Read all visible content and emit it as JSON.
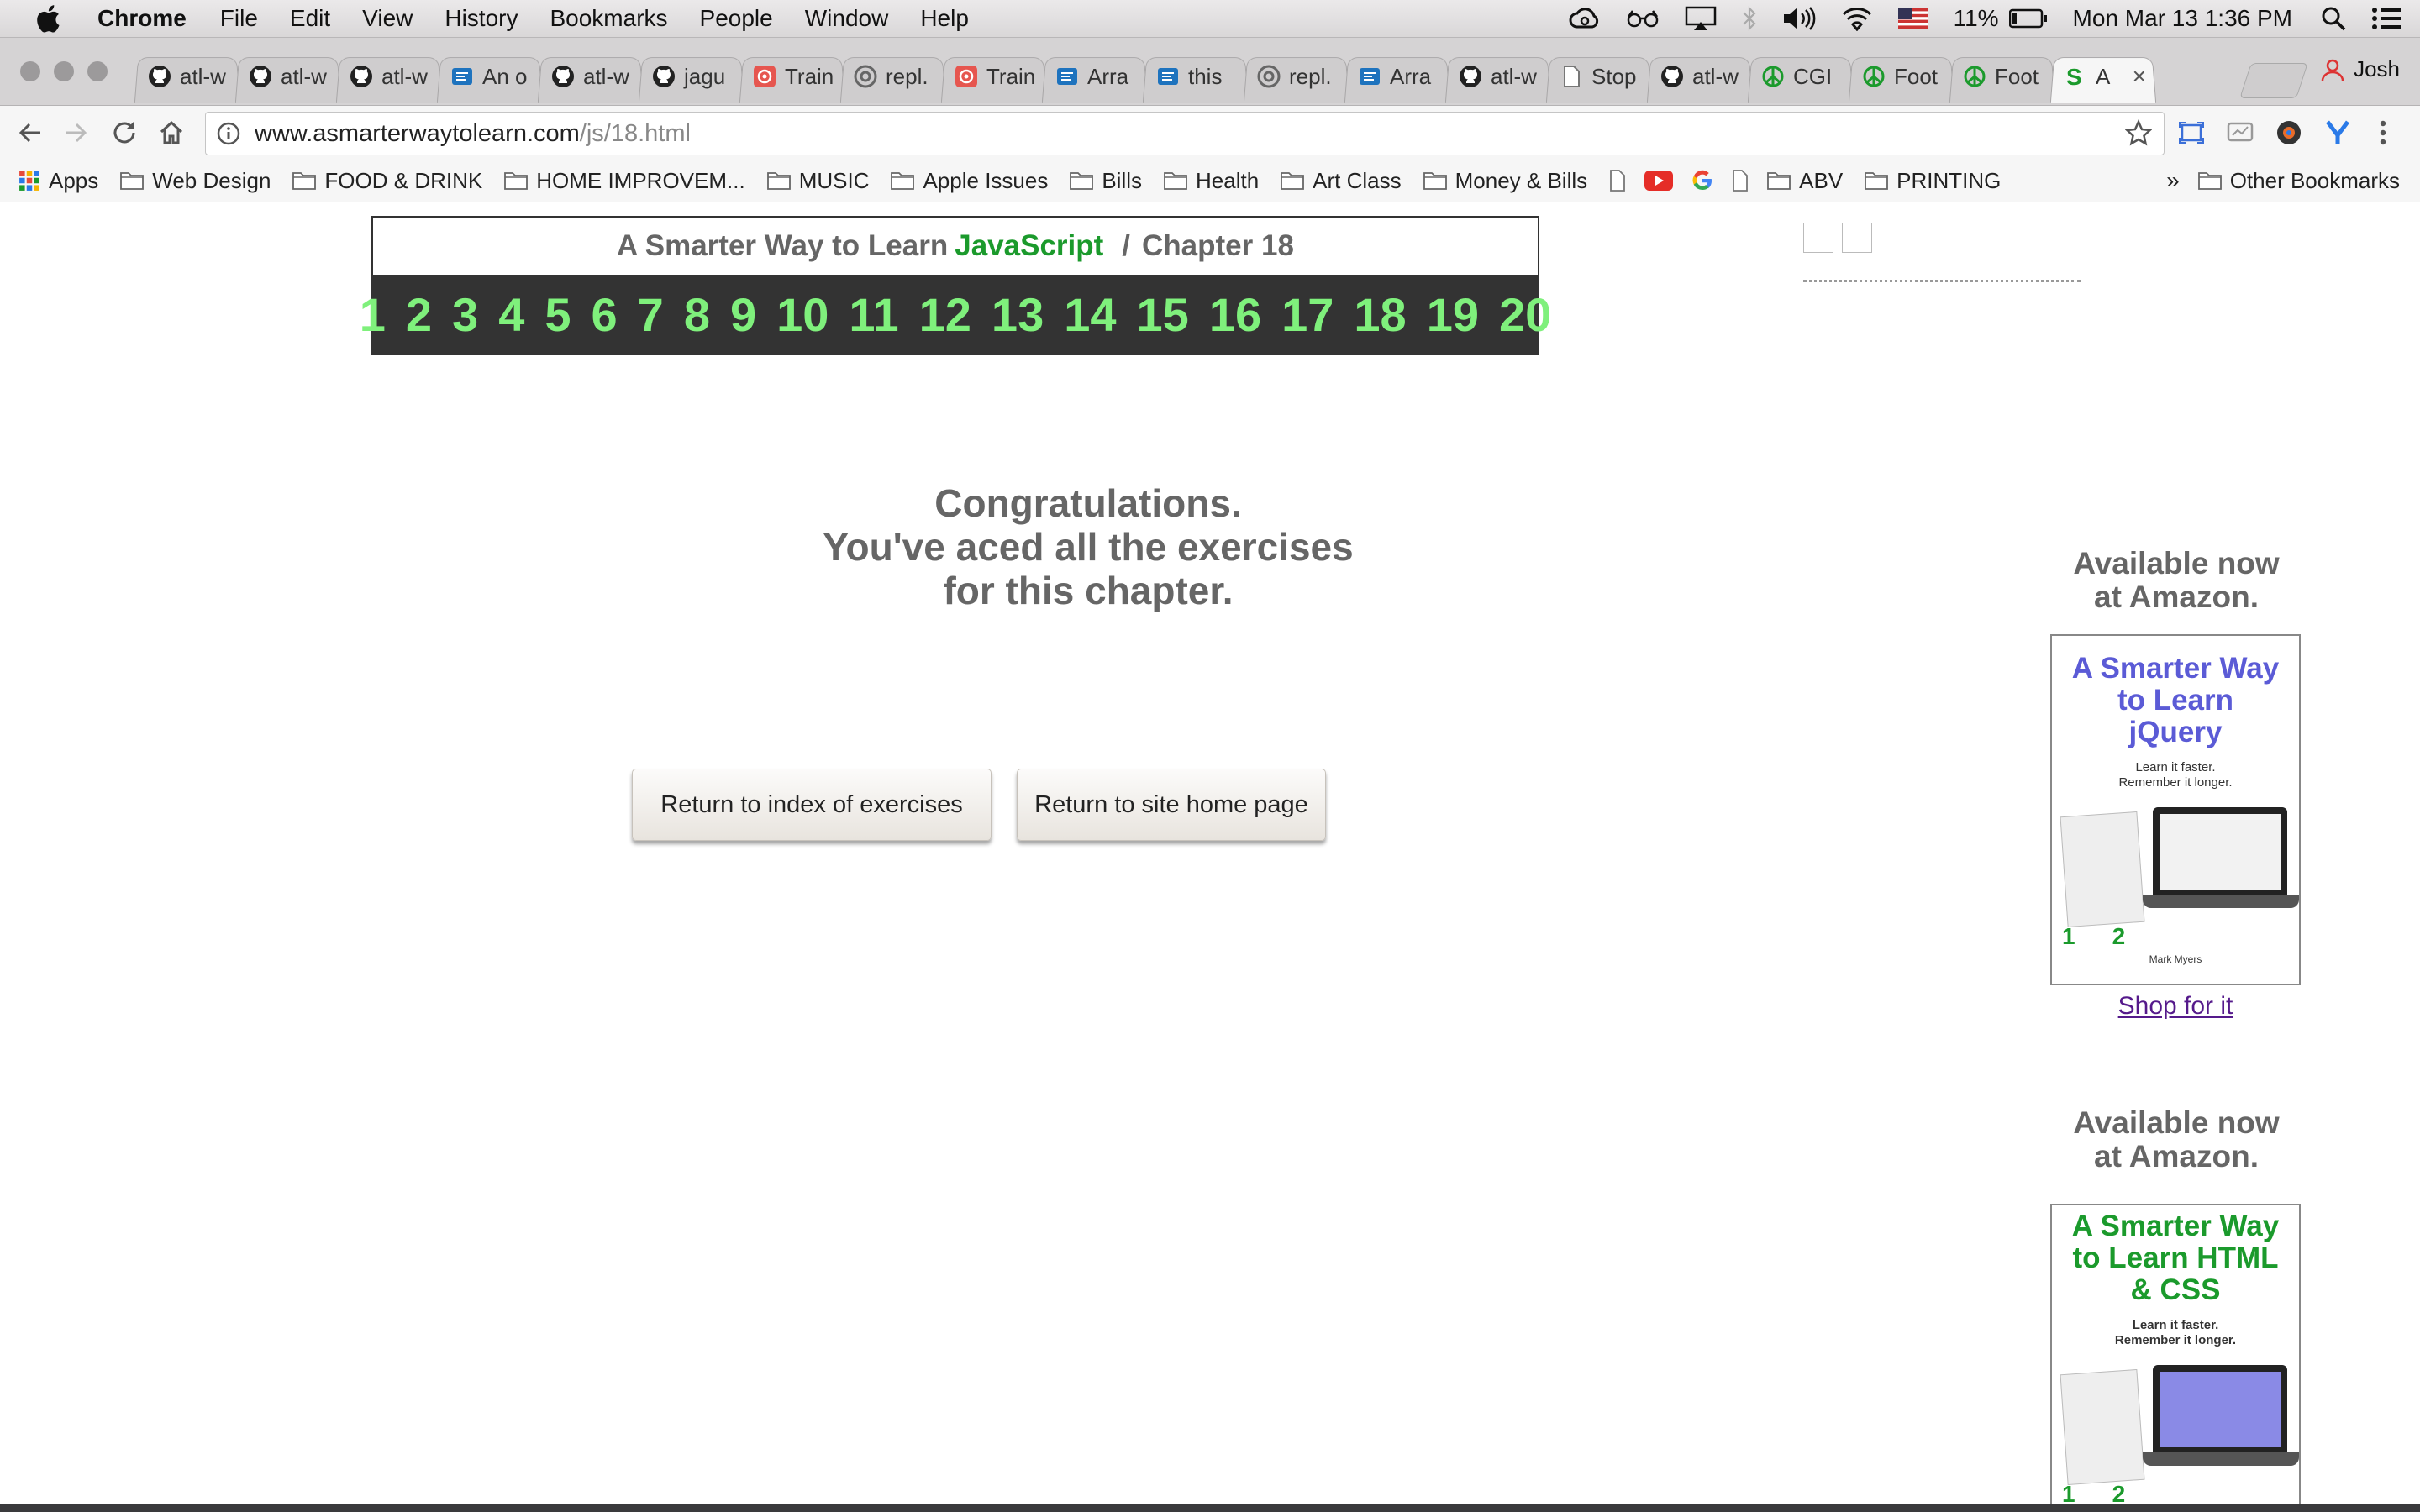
{
  "menubar": {
    "app": "Chrome",
    "items": [
      "File",
      "Edit",
      "View",
      "History",
      "Bookmarks",
      "People",
      "Window",
      "Help"
    ],
    "battery": "11%",
    "clock": "Mon Mar 13  1:36 PM"
  },
  "tabs": [
    {
      "title": "atl-w",
      "icon": "github-icon"
    },
    {
      "title": "atl-w",
      "icon": "github-icon"
    },
    {
      "title": "atl-w",
      "icon": "github-icon"
    },
    {
      "title": "An o",
      "icon": "doc-blue-icon"
    },
    {
      "title": "atl-w",
      "icon": "github-icon"
    },
    {
      "title": "jagu",
      "icon": "github-icon"
    },
    {
      "title": "Train",
      "icon": "spiral-red-icon"
    },
    {
      "title": "repl.",
      "icon": "repl-icon"
    },
    {
      "title": "Train",
      "icon": "spiral-red-icon"
    },
    {
      "title": "Arra",
      "icon": "doc-blue-icon"
    },
    {
      "title": "this",
      "icon": "doc-blue-icon"
    },
    {
      "title": "repl.",
      "icon": "repl-icon"
    },
    {
      "title": "Arra",
      "icon": "doc-blue-icon"
    },
    {
      "title": "atl-w",
      "icon": "github-icon"
    },
    {
      "title": "Stop",
      "icon": "page-icon"
    },
    {
      "title": "atl-w",
      "icon": "github-icon"
    },
    {
      "title": "CGI",
      "icon": "peace-icon"
    },
    {
      "title": "Foot",
      "icon": "peace-icon"
    },
    {
      "title": "Foot",
      "icon": "peace-icon"
    },
    {
      "title": "A",
      "icon": "s-icon",
      "active": true
    }
  ],
  "profile": "Josh",
  "url": {
    "host": "www.asmarterwaytolearn.com",
    "path": "/js/18.html"
  },
  "bookmarks": {
    "apps": "Apps",
    "folders": [
      "Web Design",
      "FOOD & DRINK",
      "HOME IMPROVEM...",
      "MUSIC",
      "Apple Issues",
      "Bills",
      "Health",
      "Art Class",
      "Money & Bills"
    ],
    "folders2": [
      "ABV",
      "PRINTING"
    ],
    "more": "»",
    "other": "Other Bookmarks"
  },
  "chapter": {
    "prefix": "A Smarter Way to Learn",
    "subject": "JavaScript",
    "sep": "/",
    "chapter_label": "Chapter 18",
    "numbers": [
      "1",
      "2",
      "3",
      "4",
      "5",
      "6",
      "7",
      "8",
      "9",
      "10",
      "11",
      "12",
      "13",
      "14",
      "15",
      "16",
      "17",
      "18",
      "19",
      "20"
    ]
  },
  "congrats": {
    "line1": "Congratulations.",
    "line2": "You've aced all the exercises",
    "line3": "for this chapter."
  },
  "buttons": {
    "index": "Return to index of exercises",
    "home": "Return to site home page"
  },
  "rail": {
    "avail_line1": "Available now",
    "avail_line2": "at Amazon.",
    "book1": {
      "title": "A Smarter Way to Learn jQuery",
      "title_color": "#5b5bd6",
      "tag1": "Learn it faster.",
      "tag2": "Remember it longer.",
      "step1": "1",
      "step2": "2",
      "author": "Mark Myers"
    },
    "shop": "Shop for it",
    "book2": {
      "title": "A Smarter Way to Learn HTML & CSS",
      "title_color": "#1b9a2c",
      "tag1": "Learn it faster.",
      "tag2": "Remember it longer.",
      "step1": "1",
      "step2": "2"
    }
  }
}
